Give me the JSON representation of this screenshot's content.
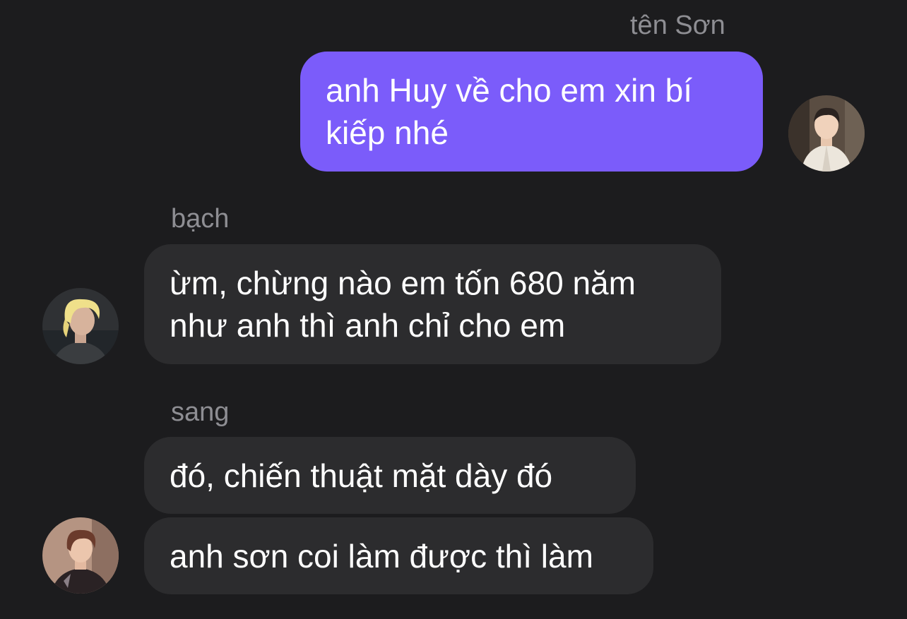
{
  "chat": {
    "background": "#1c1c1e",
    "outgoing_color": "#7b5cfa",
    "incoming_color": "#2c2c2e",
    "messages": [
      {
        "sender": "tên Sơn",
        "text": "anh Huy về cho em xin bí kiếp nhé",
        "direction": "outgoing"
      },
      {
        "sender": "bạch",
        "text": "ừm, chừng nào em tốn 680 năm như anh thì anh chỉ cho em",
        "direction": "incoming"
      },
      {
        "sender": "sang",
        "text": "đó, chiến thuật mặt dày đó",
        "direction": "incoming"
      },
      {
        "sender": "",
        "text": "anh sơn coi làm được thì làm",
        "direction": "incoming"
      }
    ],
    "avatars": [
      {
        "icon": "user-avatar-son"
      },
      {
        "icon": "user-avatar-bach"
      },
      {
        "icon": "user-avatar-sang"
      }
    ]
  }
}
